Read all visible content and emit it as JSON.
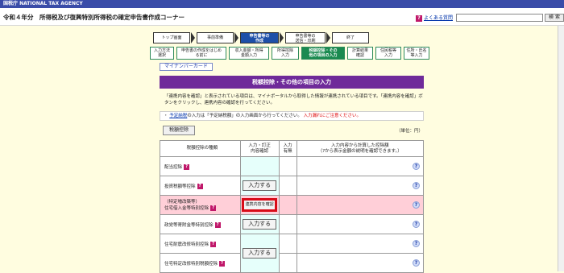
{
  "topbar": {
    "title": "国税庁 NATIONAL TAX AGENCY"
  },
  "header": {
    "title": "令和４年分　所得税及び復興特別所得税の確定申告書作成コーナー",
    "faq_label": "よくある質問",
    "search_value": "",
    "search_button": "検 索"
  },
  "steps": [
    {
      "label": "トップ画面"
    },
    {
      "label": "事前準備"
    },
    {
      "label": "申告書等の\n作成"
    },
    {
      "label": "申告書等の\n送信・印刷"
    },
    {
      "label": "終了"
    }
  ],
  "substeps": [
    {
      "label": "入力方法\n選択"
    },
    {
      "label": "申告書の作成をはじめ\nる前に"
    },
    {
      "label": "収入金額・所得\n金額入力"
    },
    {
      "label": "所得控除\n入力"
    },
    {
      "label": "税額控除・その\n他の項目の入力"
    },
    {
      "label": "計算結果\n確認"
    },
    {
      "label": "住民税等\n入力"
    },
    {
      "label": "住所・氏名\n等入力"
    }
  ],
  "mynumber_button": "マイナンバーカード",
  "banner": "税額控除・その他の項目の入力",
  "notice": "「連携内容を確認」と表示されている項目は、マイナポータルから取得した情報が連携されている項目です。「連携内容を確認」ボタンをクリックし、連携内容の確認を行ってください。",
  "smallnote": {
    "prefix": "予定納税",
    "text": "の入力は「予定納税額」の入力画面から行ってください。",
    "red": "入力漏れにご注意ください。"
  },
  "tab": "税額控除",
  "unit": "（単位：円）",
  "table": {
    "headers": [
      "税額控除の種類",
      "入力・訂正\n内容確認",
      "入力\n有無",
      "入力内容から計算した控除額\n（?から表示金額の説明を確認できます。）"
    ],
    "rows": [
      {
        "label": "配当控除",
        "button": ""
      },
      {
        "label": "投資税額等控除",
        "button": "入力する"
      },
      {
        "label": "（特定増改築等）\n住宅借入金等特別控除",
        "button": "連携内容を確認"
      },
      {
        "label": "政党等寄附金等特別控除",
        "button": "入力する"
      },
      {
        "label": "住宅耐震改修特別控除",
        "button": ""
      },
      {
        "label": "住宅特定改修特別税額控除",
        "button": "入力する"
      }
    ]
  },
  "colors": {
    "banner": "#6f2a9a",
    "current_step": "#1d4fa8",
    "current_substep": "#1a8a50",
    "highlight_row": "#ffcfd8",
    "confirm_border": "#d80c18"
  }
}
